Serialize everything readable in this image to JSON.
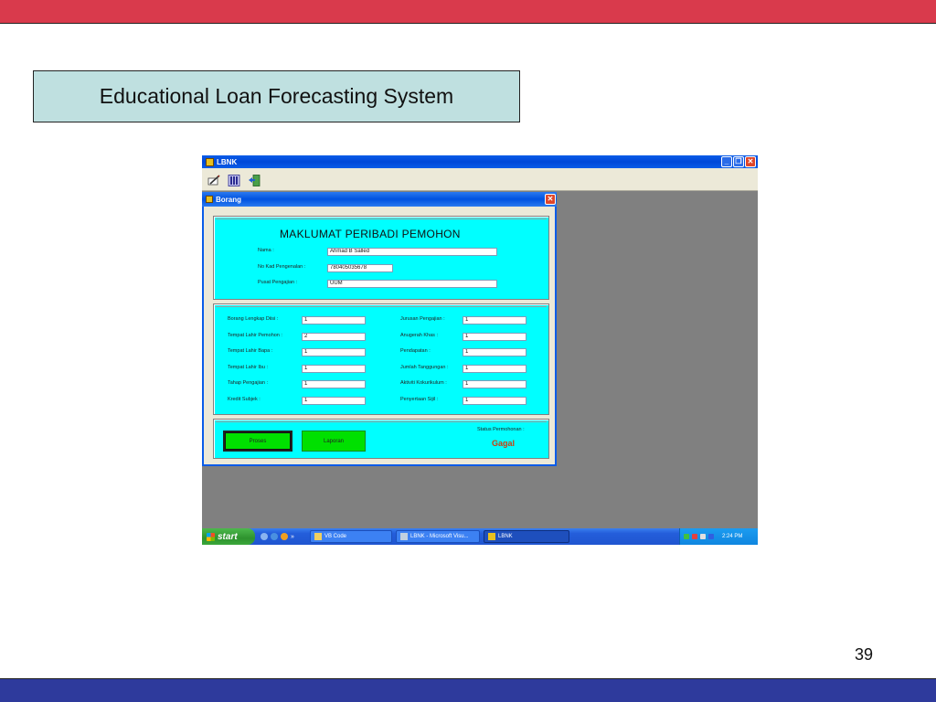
{
  "slide": {
    "title": "Educational Loan Forecasting System",
    "page_number": "39"
  },
  "app": {
    "title": "LBNK",
    "toolbar": [
      {
        "icon": "form-pen-icon"
      },
      {
        "icon": "calculator-icon"
      },
      {
        "icon": "exit-door-icon"
      }
    ]
  },
  "form": {
    "title": "Borang",
    "heading": "MAKLUMAT PERIBADI PEMOHON",
    "personal": [
      {
        "label": "Nama :",
        "value": "Ahmad B Salled"
      },
      {
        "label": "No Kad Pengenalan :",
        "value": "780405035678"
      },
      {
        "label": "Pusat Pengajian :",
        "value": "UUM"
      }
    ],
    "left_fields": [
      {
        "label": "Borang Lengkap Diisi :",
        "value": "1"
      },
      {
        "label": "Tempat Lahir Pemohon :",
        "value": "2"
      },
      {
        "label": "Tempat Lahir Bapa :",
        "value": "1"
      },
      {
        "label": "Tempat Lahir Ibu :",
        "value": "1"
      },
      {
        "label": "Tahap Pengajian :",
        "value": "1"
      },
      {
        "label": "Kredit Subjek :",
        "value": "1"
      }
    ],
    "right_fields": [
      {
        "label": "Jurusan Pengajian :",
        "value": "1"
      },
      {
        "label": "Anugerah Khas :",
        "value": "1"
      },
      {
        "label": "Pendapatan :",
        "value": "1"
      },
      {
        "label": "Jumlah Tanggungan :",
        "value": "1"
      },
      {
        "label": "Aktiviti Kokurikulum :",
        "value": "1"
      },
      {
        "label": "Penyertaan Sijil :",
        "value": "1"
      }
    ],
    "buttons": {
      "process": "Proses",
      "report": "Laporan"
    },
    "status_label": "Status Permohonan :",
    "status_value": "Gagal"
  },
  "taskbar": {
    "start": "start",
    "more": "»",
    "tasks": [
      {
        "label": "VB Code"
      },
      {
        "label": "LBNK - Microsoft Visu..."
      },
      {
        "label": "LBNK"
      }
    ],
    "clock": "2:24 PM"
  },
  "colors": {
    "top_bar": "#d93a4c",
    "bottom_bar": "#2e3a9c",
    "panel": "#00ffff",
    "button_green": "#00e000",
    "status_fail": "#c84010"
  }
}
